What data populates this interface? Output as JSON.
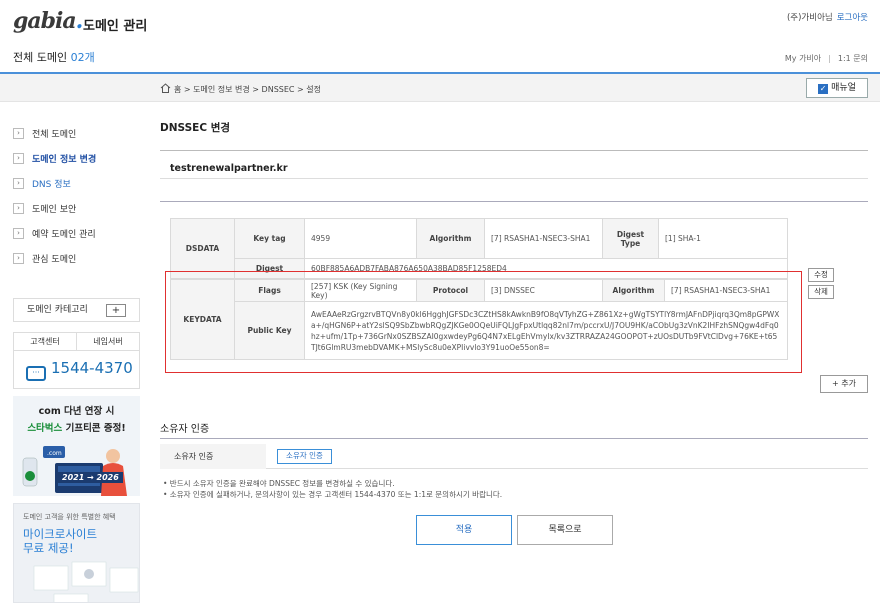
{
  "header": {
    "logo_text": "gabia",
    "logo_dot": ".",
    "service_title": "도메인 관리",
    "user_name": "(주)가비아님",
    "logout": "로그아웃",
    "count_label": "전체 도메인",
    "count_value": "02개",
    "my_gabia": "My 가비아",
    "separator": "|",
    "inquiry": "1:1 문의"
  },
  "breadcrumb": {
    "home": "홈",
    "path": " > 도메인 정보 변경 > DNSSEC > 설정",
    "manual_label": "매뉴얼",
    "manual_check": "✓"
  },
  "sidebar": {
    "items": [
      {
        "label": "전체 도메인"
      },
      {
        "label": "도메인 정보 변경"
      },
      {
        "label": "DNS 정보"
      },
      {
        "label": "도메인 보안"
      },
      {
        "label": "예약 도메인 관리"
      },
      {
        "label": "관심 도메인"
      }
    ],
    "category_label": "도메인 카테고리",
    "category_add": "+",
    "cs_tab1": "고객센터",
    "cs_tab2": "네임서버",
    "cs_phone_prefix": "1544-",
    "cs_phone_suffix": "4370",
    "promo1_line1": "com 다년 연장 시",
    "promo1_line2a": "스타벅스",
    "promo1_line2b": " 기프티콘 증정!",
    "promo1_badge": ".com",
    "promo1_years": "2021 → 2026",
    "promo2_small": "도메인 고객을 위한 특별한 혜택",
    "promo2_big1": "마이크로사이트",
    "promo2_big2": "무료 제공!"
  },
  "main": {
    "title": "DNSSEC 변경",
    "domain": "testrenewalpartner.kr",
    "dsdata": {
      "section": "DSDATA",
      "keytag_label": "Key tag",
      "keytag_value": "4959",
      "algorithm_label": "Algorithm",
      "algorithm_value": "[7] RSASHA1-NSEC3-SHA1",
      "digest_type_label": "Digest Type",
      "digest_type_value": "[1] SHA-1",
      "digest_label": "Digest",
      "digest_value": "60BF885A6ADB7FABA876A650A38BAD85F1258ED4"
    },
    "keydata": {
      "section": "KEYDATA",
      "flags_label": "Flags",
      "flags_value": "[257] KSK (Key Signing Key)",
      "protocol_label": "Protocol",
      "protocol_value": "[3] DNSSEC",
      "algorithm_label": "Algorithm",
      "algorithm_value": "[7] RSASHA1-NSEC3-SHA1",
      "publickey_label": "Public Key",
      "publickey_value": "AwEAAeRzGrgzrvBTQVn8y0kl6HgghJGFSDc3CZtHS8kAwknB9fO8qVTyhZG+Z861Xz+gWgTSYTlY8rmJAFnDPjiqrq3Qm8pGPWXa+/qHGN6P+atY2slSQ9SbZbwbRQgZJKGe0OQeUiFQLJgFpxUtlqq82nl7m/pccrxU/J7OU9HK/aCObUg3zVnK2IHFzhSNQgw4dFq0hz+ufm/1Tp+736GrNx0SZBSZAI0gxwdeyPg6Q4N7xELgEhVmyIx/kv3ZTRRAZA24GOOPOT+zUOsDUTb9FVtClDvg+76KE+t65TJt6GlmRU3mebDVAMK+MSlySc8u0eXPIivvlo3Y91uoOe55on8="
    },
    "edit_label": "수정",
    "delete_label": "삭제",
    "add_label": "+ 추가",
    "owner_title": "소유자 인증",
    "owner_row_label": "소유자 인증",
    "owner_button": "소유자 인증",
    "notes": [
      "• 반드시 소유자 인증을 완료해야 DNSSEC 정보를 변경하실 수 있습니다.",
      "• 소유자 인증에 실패하거나, 문의사항이 있는 경우 고객센터 1544-4370 또는 1:1로 문의하시기 바랍니다."
    ],
    "apply_label": "적용",
    "list_label": "목록으로"
  }
}
